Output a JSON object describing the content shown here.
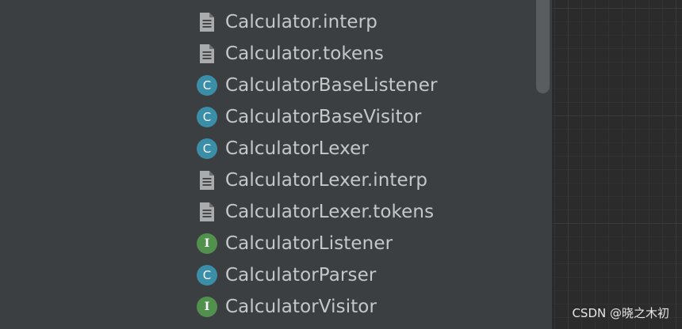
{
  "project_tree": {
    "items": [
      {
        "label": "Calculator.interp",
        "icon": "file-icon",
        "kind": "file"
      },
      {
        "label": "Calculator.tokens",
        "icon": "file-icon",
        "kind": "file"
      },
      {
        "label": "CalculatorBaseListener",
        "icon": "class-icon",
        "kind": "class",
        "badge": "C"
      },
      {
        "label": "CalculatorBaseVisitor",
        "icon": "class-icon",
        "kind": "class",
        "badge": "C"
      },
      {
        "label": "CalculatorLexer",
        "icon": "class-icon",
        "kind": "class",
        "badge": "C"
      },
      {
        "label": "CalculatorLexer.interp",
        "icon": "file-icon",
        "kind": "file"
      },
      {
        "label": "CalculatorLexer.tokens",
        "icon": "file-icon",
        "kind": "file"
      },
      {
        "label": "CalculatorListener",
        "icon": "interface-icon",
        "kind": "interface",
        "badge": "I"
      },
      {
        "label": "CalculatorParser",
        "icon": "class-icon",
        "kind": "class",
        "badge": "C"
      },
      {
        "label": "CalculatorVisitor",
        "icon": "interface-icon",
        "kind": "interface",
        "badge": "I"
      }
    ]
  },
  "watermark": {
    "text": "CSDN @晓之木初"
  },
  "colors": {
    "panel_background": "#3c3f41",
    "editor_background": "#2b2b2b",
    "class_badge": "#3b8ea7",
    "interface_badge": "#52904d",
    "label_text": "#c5c8c8"
  }
}
